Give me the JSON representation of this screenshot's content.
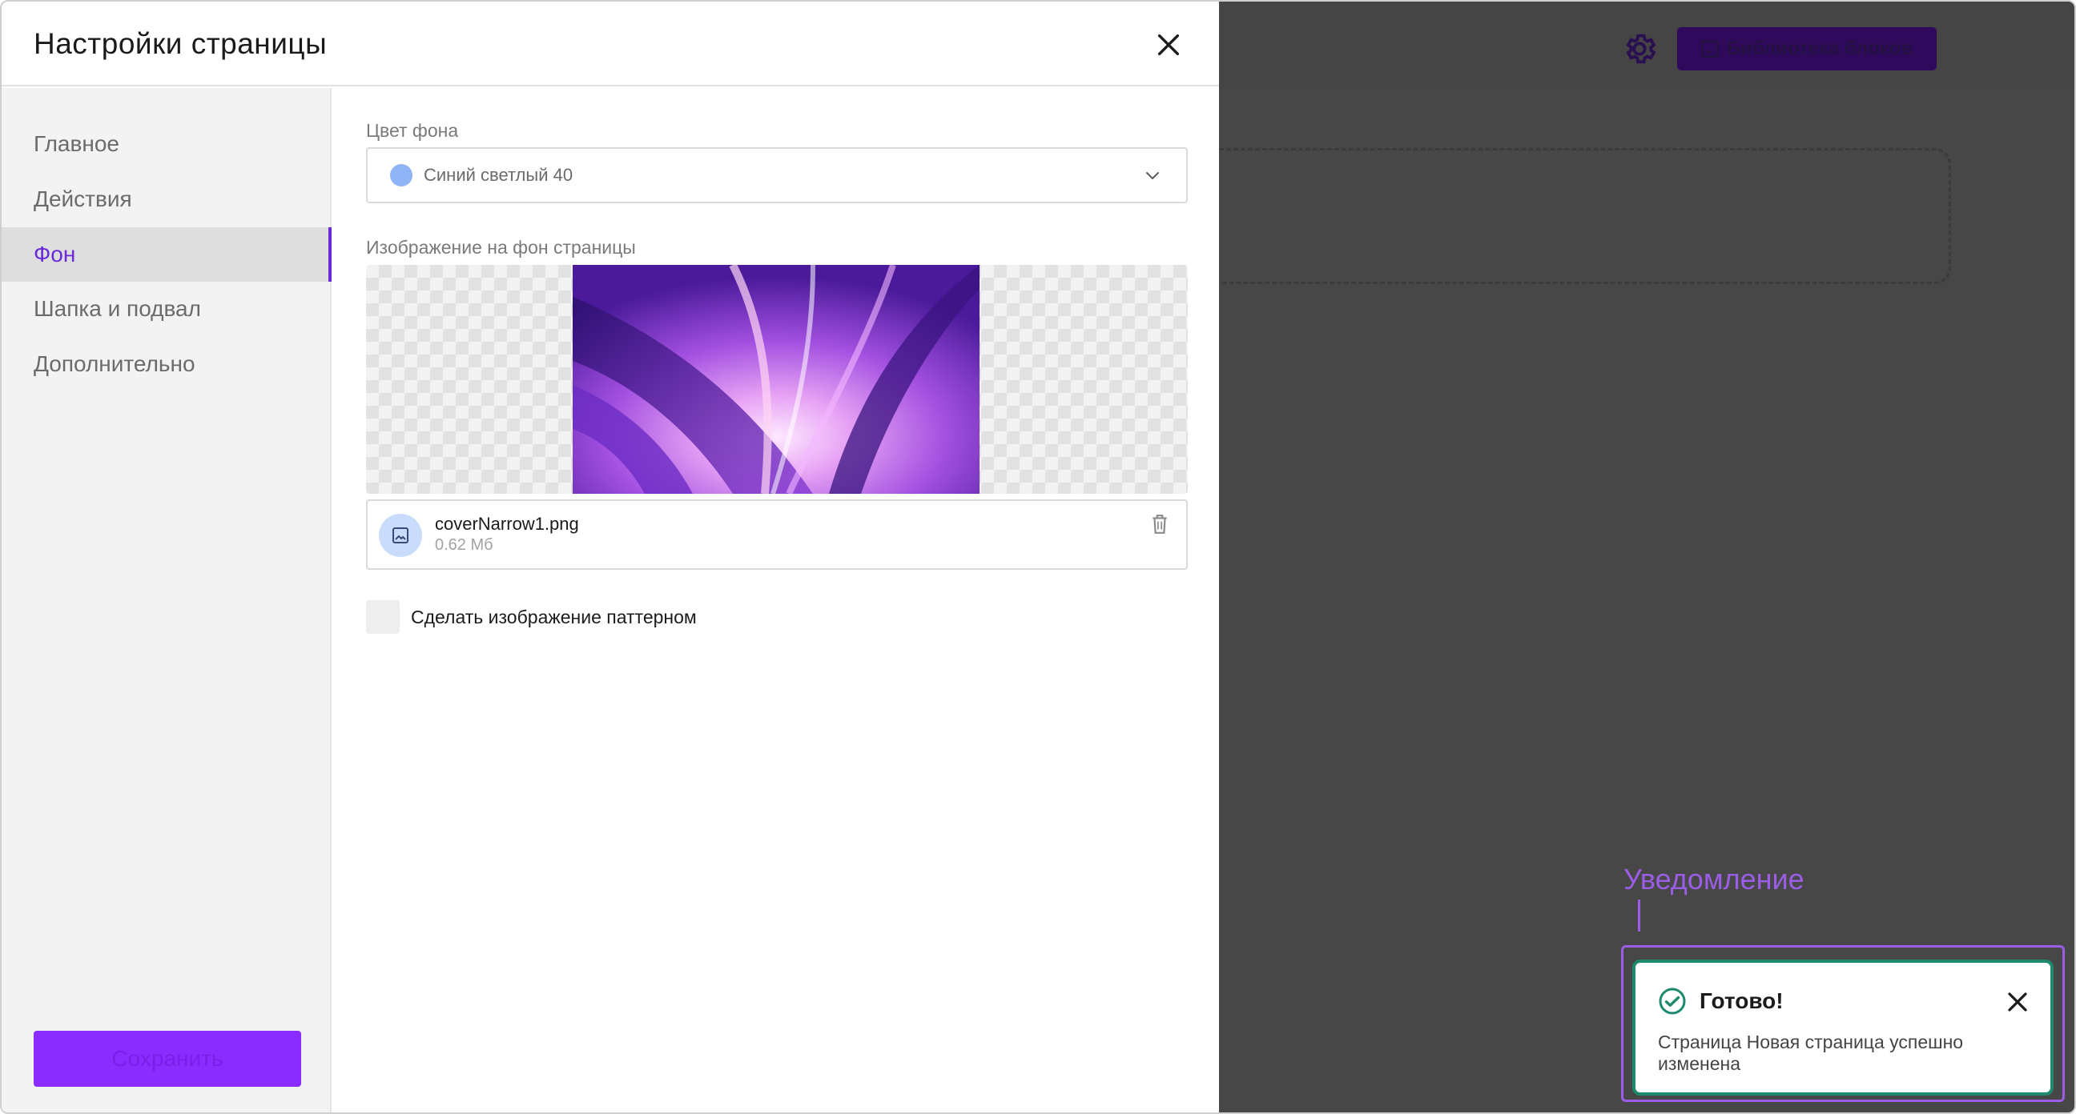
{
  "dialog": {
    "title": "Настройки страницы",
    "nav": [
      {
        "label": "Главное",
        "active": false
      },
      {
        "label": "Действия",
        "active": false
      },
      {
        "label": "Фон",
        "active": true
      },
      {
        "label": "Шапка и подвал",
        "active": false
      },
      {
        "label": "Дополнительно",
        "active": false
      }
    ],
    "save_label": "Сохранить",
    "background_color": {
      "label": "Цвет фона",
      "selected": "Синий светлый 40",
      "swatch_color": "#8fb4f5"
    },
    "background_image": {
      "label": "Изображение на фон страницы",
      "file_name": "coverNarrow1.png",
      "file_size": "0.62 Мб"
    },
    "pattern_checkbox": {
      "label": "Сделать изображение паттерном",
      "checked": false
    }
  },
  "backdrop": {
    "library_button": "Библиотека блоков"
  },
  "annotation": {
    "label": "Уведомление"
  },
  "toast": {
    "title": "Готово!",
    "message": "Страница Новая страница успешно изменена",
    "status_color": "#1d8a6e"
  },
  "colors": {
    "accent": "#8a2cff",
    "active_nav": "#6a2ad8",
    "annotation": "#9b5de5",
    "backdrop": "#474747"
  }
}
